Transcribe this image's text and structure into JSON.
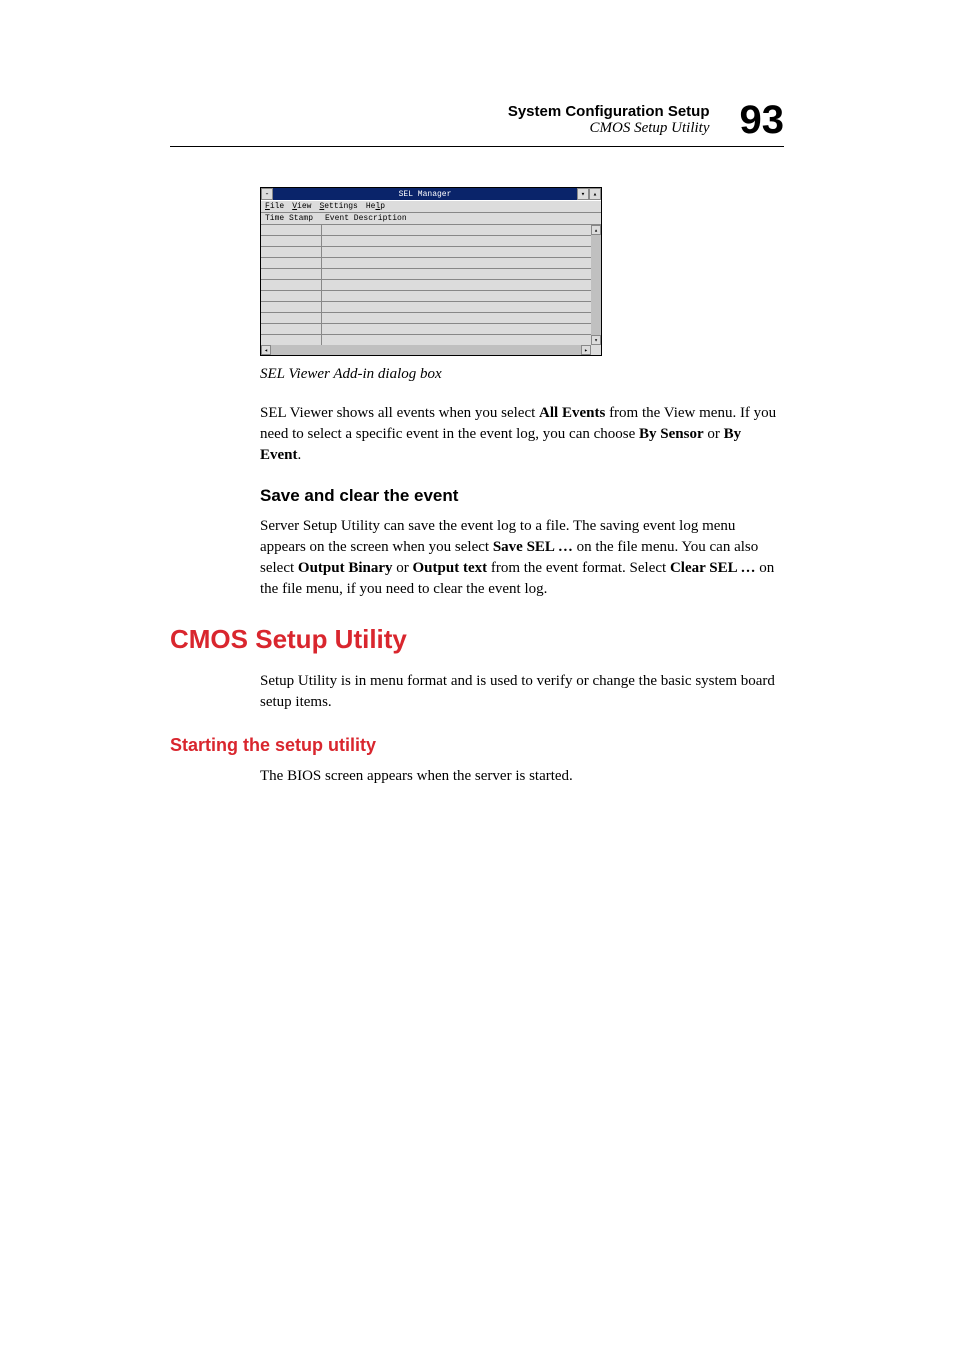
{
  "header": {
    "title": "System Configuration Setup",
    "subtitle": "CMOS Setup Utility",
    "page_number": "93"
  },
  "sel_dialog": {
    "title": "SEL Manager",
    "menu": {
      "file": "File",
      "view": "View",
      "settings": "Settings",
      "help": "Help"
    },
    "columns": {
      "time_stamp": "Time Stamp",
      "event_description": "Event Description"
    }
  },
  "caption": "SEL Viewer Add-in dialog box",
  "para1": {
    "pre": "SEL Viewer shows all events when you select ",
    "b1": "All Events",
    "mid1": " from the View menu. If you need to select a specific event in the event log, you can choose ",
    "b2": "By Sensor",
    "mid2": " or ",
    "b3": "By Event",
    "post": "."
  },
  "h2_save": "Save and clear the event",
  "para2": {
    "pre": "Server Setup Utility can save the event log to a file. The saving event log menu appears on the screen when you select ",
    "b1": "Save SEL …",
    "mid1": " on the file menu. You can also select ",
    "b2": "Output Binary",
    "mid2": " or ",
    "b3": "Output text",
    "mid3": " from the event format. Select ",
    "b4": "Clear SEL …",
    "post": " on the file menu, if you need to clear the event log."
  },
  "h1_cmos": "CMOS Setup Utility",
  "para3": "Setup Utility is in menu format and is used to verify or change the basic system board setup items.",
  "h3_start": "Starting the setup utility",
  "para4": "The BIOS screen appears when the server is started."
}
